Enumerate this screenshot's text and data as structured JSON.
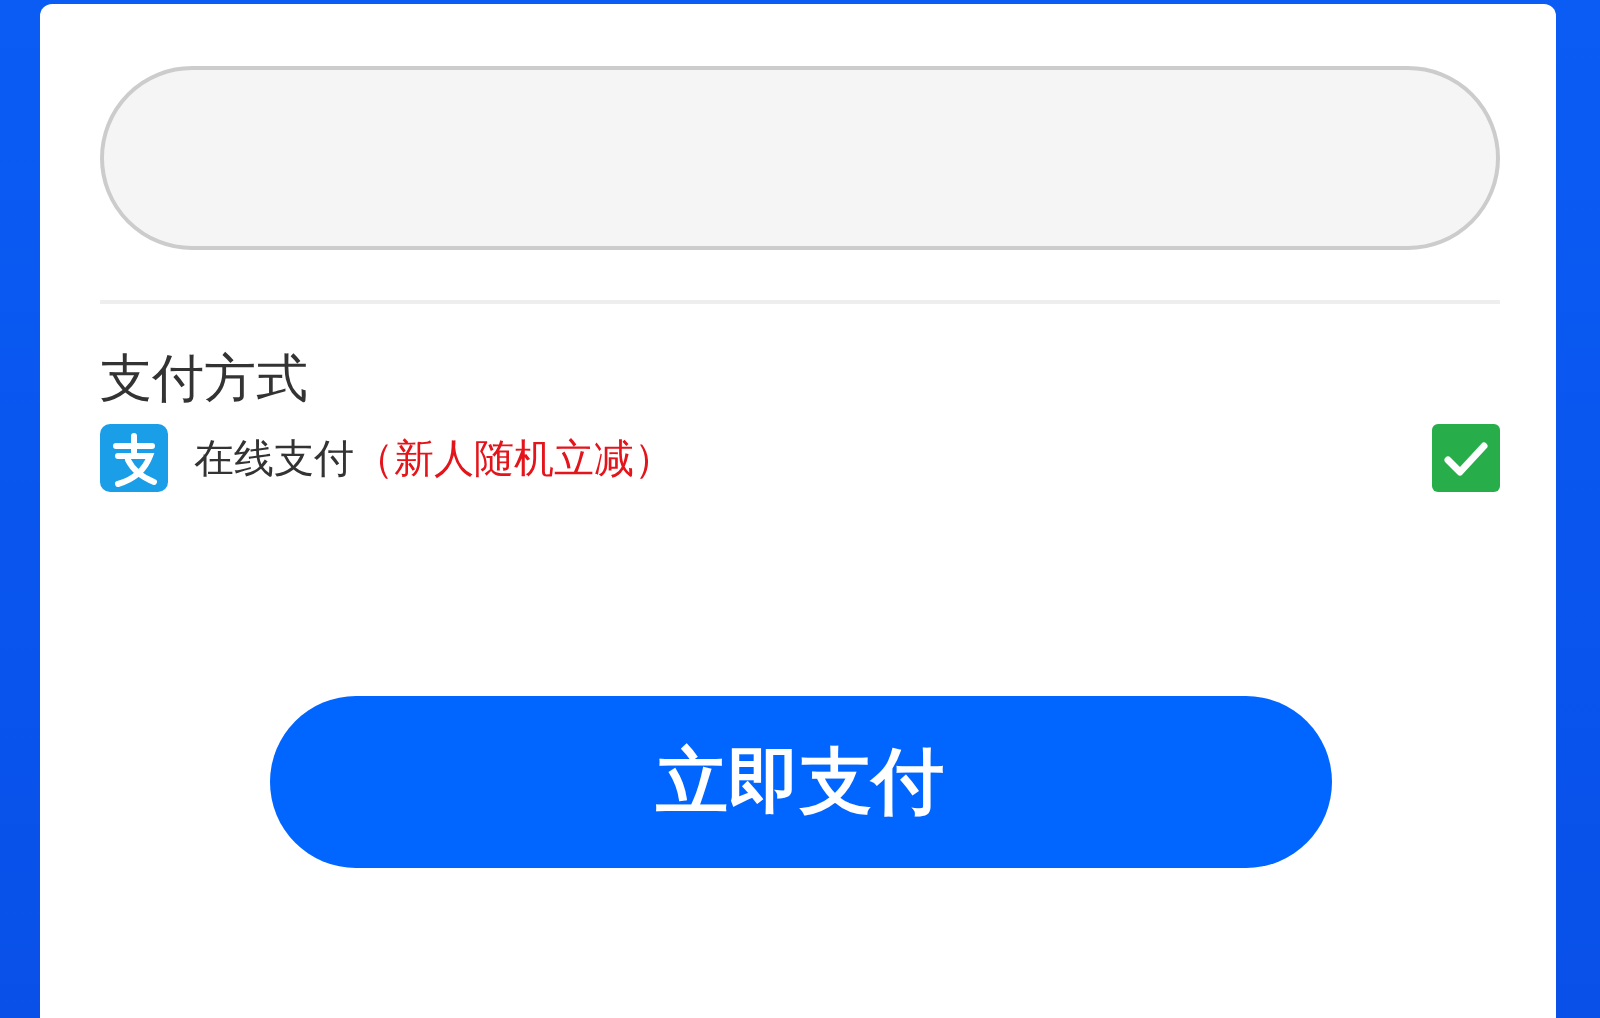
{
  "section_title": "支付方式",
  "payment_methods": [
    {
      "label": "在线支付",
      "promo": "（新人随机立减）",
      "checked": true
    }
  ],
  "pay_button": "立即支付"
}
